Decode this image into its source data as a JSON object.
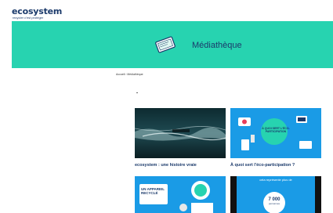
{
  "header": {
    "logo_main": "ecosystem",
    "tagline": "recycler c'est protéger"
  },
  "hero": {
    "title": "Médiathèque",
    "icon": "tablet-icon",
    "bg_color": "#27d3b0"
  },
  "breadcrumb": {
    "text": "Accueil › Médiathèque"
  },
  "cards": [
    {
      "title": "ecosystem : une histoire vraie",
      "thumb_text": ""
    },
    {
      "title": "À quoi sert l'éco-participation ?",
      "thumb_text": "À QUOI SERT L'ÉCO-PARTICIPATION"
    },
    {
      "title": "",
      "thumb_text": "UN APPAREIL RECYCLÉ"
    },
    {
      "title": "",
      "thumb_text_top": "cela représente plus de",
      "thumb_text_num": "7 000",
      "thumb_text_unit": "personnes"
    }
  ],
  "colors": {
    "brand_navy": "#1b3a6b",
    "brand_teal": "#27d3b0",
    "thumb_blue": "#1a9be6"
  }
}
